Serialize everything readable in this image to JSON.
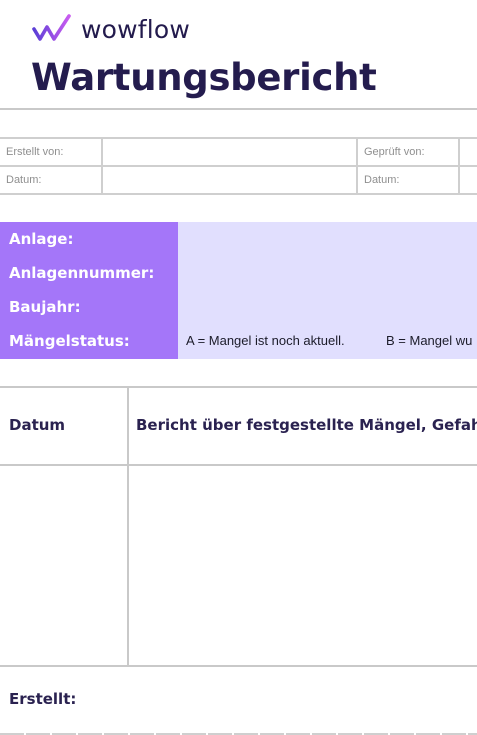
{
  "brand": {
    "logo_text": "wowflow",
    "accent": "#a476f9"
  },
  "document": {
    "title": "Wartungsbericht"
  },
  "meta": {
    "created_by_label": "Erstellt von:",
    "checked_by_label": "Geprüft von:",
    "date_label_left": "Datum:",
    "date_label_right": "Datum:"
  },
  "plant": {
    "labels": [
      "Anlage:",
      "Anlagennummer:",
      "Baujahr:",
      "Mängelstatus:"
    ],
    "status_a": "A = Mangel ist noch aktuell.",
    "status_b": "B = Mangel wu",
    "label_bg": "#a476f9",
    "field_bg": "#e1dffe"
  },
  "report": {
    "col_date": "Datum",
    "col_report": "Bericht über festgestellte Mängel, Gefahre"
  },
  "footer": {
    "created_label": "Erstellt:"
  }
}
